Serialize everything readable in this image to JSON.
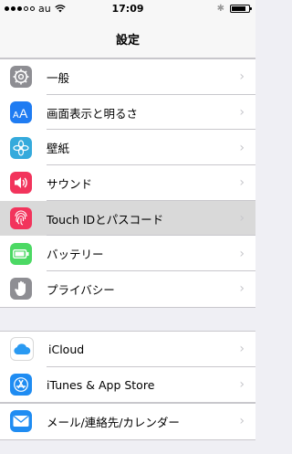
{
  "status_bar": {
    "carrier": "au",
    "time": "17:09",
    "signal_bars": 3,
    "battery_level": 0.85
  },
  "nav": {
    "title": "設定"
  },
  "groups": [
    [
      {
        "name": "general",
        "label": "一般",
        "icon": "gear-icon",
        "color": "#8e8e93"
      },
      {
        "name": "display",
        "label": "画面表示と明るさ",
        "icon": "text-size-icon",
        "color": "#1f7cf2"
      },
      {
        "name": "wallpaper",
        "label": "壁紙",
        "icon": "flower-icon",
        "color": "#35aadc"
      },
      {
        "name": "sounds",
        "label": "サウンド",
        "icon": "speaker-icon",
        "color": "#f2345c"
      },
      {
        "name": "touchid",
        "label": "Touch IDとパスコード",
        "icon": "fingerprint-icon",
        "color": "#f2345c",
        "highlight": true
      },
      {
        "name": "battery",
        "label": "バッテリー",
        "icon": "battery-icon",
        "color": "#4cd964"
      },
      {
        "name": "privacy",
        "label": "プライバシー",
        "icon": "hand-icon",
        "color": "#8e8e93"
      }
    ],
    [
      {
        "name": "icloud",
        "label": "iCloud",
        "icon": "cloud-icon",
        "color": "#ffffff"
      },
      {
        "name": "itunes",
        "label": "iTunes & App Store",
        "icon": "app-store-icon",
        "color": "#1f8cf2"
      }
    ],
    [
      {
        "name": "mail",
        "label": "メール/連絡先/カレンダー",
        "icon": "mail-icon",
        "color": "#1f8cf2"
      }
    ]
  ]
}
